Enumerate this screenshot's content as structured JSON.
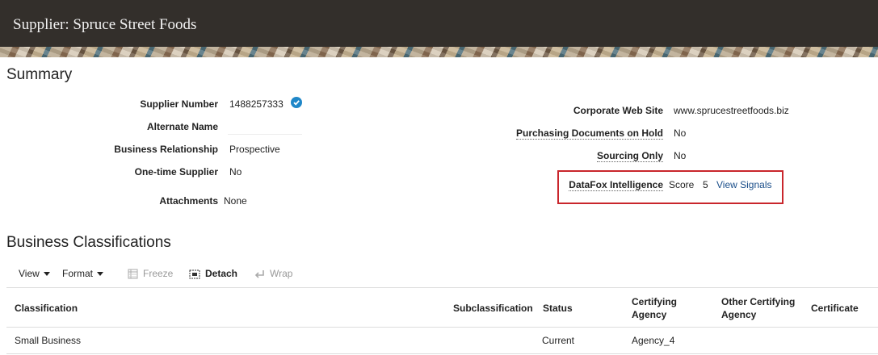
{
  "header": {
    "title": "Supplier: Spruce Street Foods"
  },
  "summary": {
    "title": "Summary",
    "left": [
      {
        "label": "Supplier Number",
        "value": "1488257333"
      },
      {
        "label": "Alternate Name",
        "value": ""
      },
      {
        "label": "Business Relationship",
        "value": "Prospective"
      },
      {
        "label": "One-time Supplier",
        "value": "No"
      },
      {
        "label": "Attachments",
        "value": "None"
      }
    ],
    "right": [
      {
        "label": "Corporate Web Site",
        "value": "www.sprucestreetfoods.biz"
      },
      {
        "label": "Purchasing Documents on Hold",
        "value": "No"
      },
      {
        "label": "Sourcing Only",
        "value": "No"
      }
    ],
    "datafox": {
      "label": "DataFox Intelligence",
      "score_label": "Score",
      "score": "5",
      "link": "View Signals"
    }
  },
  "classifications": {
    "title": "Business Classifications",
    "toolbar": {
      "view": "View",
      "format": "Format",
      "freeze": "Freeze",
      "detach": "Detach",
      "wrap": "Wrap"
    },
    "columns": [
      "Classification",
      "Subclassification",
      "Status",
      "Certifying Agency",
      "Other Certifying Agency",
      "Certificate"
    ],
    "column_lines": [
      [
        "Certifying",
        "Agency"
      ],
      [
        "Other Certifying",
        "Agency"
      ]
    ],
    "rows": [
      {
        "classification": "Small Business",
        "subclassification": "",
        "status": "Current",
        "agency": "Agency_4",
        "other_agency": "",
        "certificate": ""
      }
    ]
  }
}
